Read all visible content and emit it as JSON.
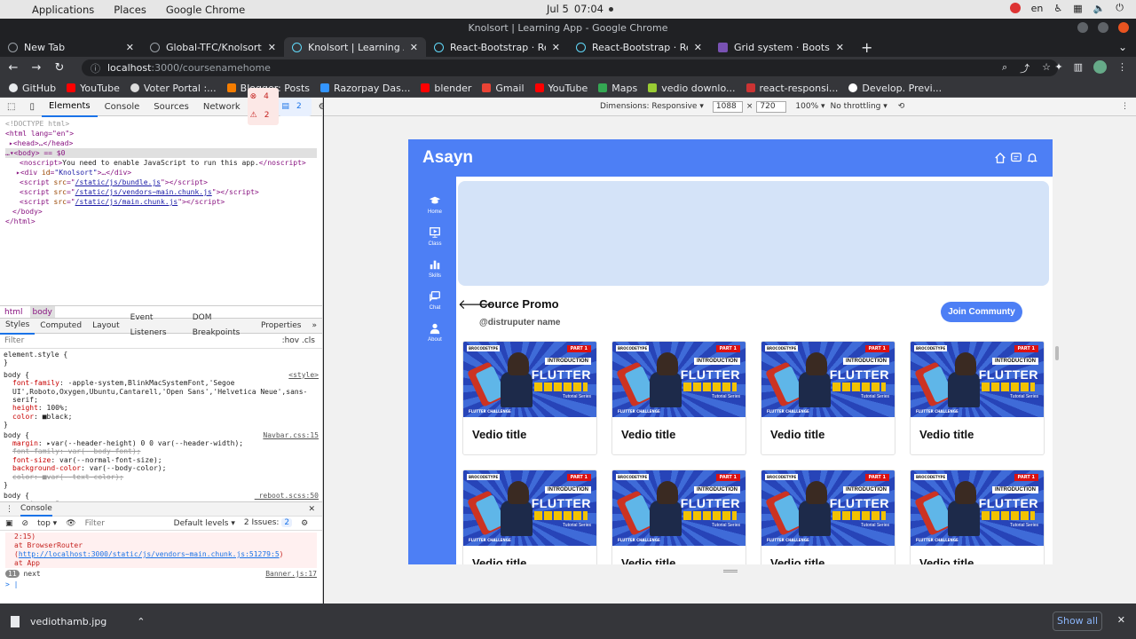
{
  "os": {
    "applications": "Applications",
    "places": "Places",
    "active_app": "Google Chrome",
    "date": "Jul 5",
    "time": "07:04",
    "lang": "en"
  },
  "window": {
    "title": "Knolsort | Learning App - Google Chrome"
  },
  "tabs": [
    {
      "label": "New Tab",
      "active": false
    },
    {
      "label": "Global-TFC/Knolsort: Adv",
      "active": false
    },
    {
      "label": "Knolsort | Learning App",
      "active": true
    },
    {
      "label": "React-Bootstrap · React-B",
      "active": false
    },
    {
      "label": "React-Bootstrap · React-B",
      "active": false
    },
    {
      "label": "Grid system · Bootstrap",
      "active": false
    }
  ],
  "address": {
    "host": "localhost",
    "path": ":3000/coursenamehome"
  },
  "bookmarks": [
    "GitHub",
    "YouTube",
    "Voter Portal :...",
    "Blogger: Posts",
    "Razorpay Das...",
    "blender",
    "Gmail",
    "YouTube",
    "Maps",
    "vedio downlo...",
    "react-responsi...",
    "Develop. Previ..."
  ],
  "devtools": {
    "tabs": [
      "Elements",
      "Console",
      "Sources",
      "Network"
    ],
    "errors": "4",
    "warnings": "2",
    "info": "2",
    "dom": {
      "doctype": "<!DOCTYPE html>",
      "html_open": "<html lang=\"en\">",
      "head": "<head>…</head>",
      "body_open": "<body> == $0",
      "noscript": "You need to enable JavaScript to run this app.",
      "div_id": "Knolsort",
      "script1": "/static/js/bundle.js",
      "script2": "/static/js/vendors~main.chunk.js",
      "script3": "/static/js/main.chunk.js",
      "body_close": "</body>",
      "html_close": "</html>"
    },
    "crumbs": [
      "html",
      "body"
    ],
    "style_tabs": [
      "Styles",
      "Computed",
      "Layout",
      "Event Listeners",
      "DOM Breakpoints",
      "Properties"
    ],
    "filter_placeholder": "Filter",
    "filter_right": ":hov .cls",
    "css_rules": {
      "element_style": "element.style {",
      "style_src": "<style>",
      "navbar_src": "Navbar.css:15",
      "reboot_src": "_reboot.scss:50",
      "font_family": "-apple-system,BlinkMacSystemFont,'Segoe UI',Roboto,Oxygen,Ubuntu,Cantarell,'Open Sans','Helvetica Neue',sans-serif;",
      "height": "100%;",
      "color": "black;",
      "margin": "var(--header-height) 0 0 var(--header-width);",
      "font_family2": "var(--body-font);",
      "font_size": "var(--normal-font-size);",
      "bg": "var(--body-color);",
      "color2": "var(--text-color);",
      "margin2": "0;"
    },
    "console": {
      "title": "Console",
      "top": "top",
      "filter": "Filter",
      "levels": "Default levels",
      "issues": "2 Issues:",
      "issues_count": "2",
      "line1": "2:15)",
      "line2_prefix": "at BrowserRouter (",
      "line2_link": "http://localhost:3000/static/js/vendors~main.chunk.js:51279:5",
      "line3": "at App",
      "count": "11",
      "msg": "next",
      "msg_src": "Banner.js:17",
      "prompt": ">"
    }
  },
  "device_toolbar": {
    "dimensions": "Dimensions: Responsive",
    "width": "1088",
    "height": "720",
    "zoom": "100%",
    "throttle": "No throttling"
  },
  "app": {
    "brand": "Asayn",
    "sidebar": [
      "Home",
      "Class",
      "Skills",
      "Chat",
      "About"
    ],
    "course_title": "Cource Promo",
    "course_sub": "@distruputer name",
    "join": "Join Communty",
    "video_title": "Vedio title",
    "thumb": {
      "logo": "BROCODETYPE",
      "part": "PART 1",
      "intro": "INTRODUCTION",
      "flutter": "FLUTTER",
      "series": "Tutorial Series",
      "challenge": "FLUTTER CHALLENGE"
    },
    "colors": {
      "primary": "#4d7ff5",
      "banner": "#d4e3f8"
    }
  },
  "download": {
    "file": "vediothamb.jpg",
    "show_all": "Show all"
  }
}
